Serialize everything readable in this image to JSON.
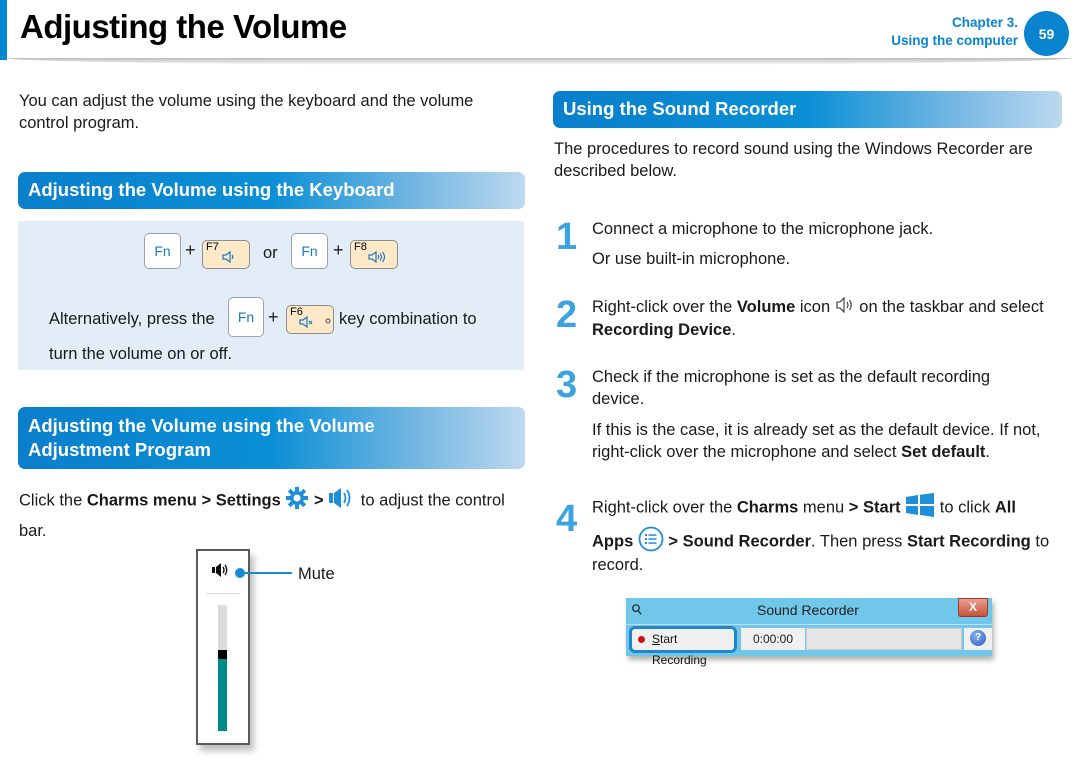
{
  "header": {
    "title": "Adjusting the Volume",
    "chapter_line1": "Chapter 3.",
    "chapter_line2": "Using the computer",
    "page_number": "59",
    "accent_color": "#0a84cf"
  },
  "left": {
    "intro": "You can adjust the volume using the keyboard and the volume control program.",
    "section1": {
      "heading": "Adjusting the Volume using the Keyboard",
      "combo1": {
        "key1": "Fn",
        "plus": "+",
        "key2_label": "F7",
        "key2_icon": "volume-down-icon"
      },
      "or_text": "or",
      "combo2": {
        "key1": "Fn",
        "plus": "+",
        "key2_label": "F8",
        "key2_icon": "volume-up-icon"
      },
      "alt_text_before": "Alternatively, press the",
      "alt_key1": "Fn",
      "alt_plus": "+",
      "alt_key2_label": "F6",
      "alt_key2_icon": "mute-icon",
      "alt_text_after": "key combination to",
      "alt_text_line2": "turn the volume on or off."
    },
    "section2": {
      "heading_line1": "Adjusting the Volume using the Volume",
      "heading_line2": "Adjustment Program",
      "text_prefix": "Click the ",
      "charms": "Charms menu",
      "sep1": " > ",
      "settings": "Settings",
      "sep2": " > ",
      "text_suffix": " to adjust the control",
      "text_line2": "bar.",
      "mute_label": "Mute",
      "volume_level_percent": 57
    }
  },
  "right": {
    "heading": "Using the Sound Recorder",
    "intro": "The procedures to record sound using the Windows Recorder are described below.",
    "steps": [
      {
        "number": "1",
        "line1": "Connect a microphone to the microphone jack.",
        "line2": "Or use built-in microphone."
      },
      {
        "number": "2",
        "t1": "Right-click over the ",
        "b1": "Volume",
        "t2": " icon ",
        "t3": " on the taskbar and select",
        "b2": "Recording Device",
        "t4": "."
      },
      {
        "number": "3",
        "line1": "Check if the microphone is set as the default recording device.",
        "t1": "If this is the case, it is already set as the default device. If not, right-click over the microphone and select ",
        "b1": "Set default",
        "t2": "."
      },
      {
        "number": "4",
        "t1": "Right-click over the ",
        "b1": "Charms",
        "t2": " menu ",
        "b2": "> Start",
        "t3": " to click ",
        "b3": "All",
        "b4": "Apps",
        "b5": " > Sound Recorder",
        "t4": ". Then press ",
        "b6": "Start Recording",
        "t5": " to",
        "t6": "record."
      }
    ],
    "recorder": {
      "title": "Sound Recorder",
      "close_label": "X",
      "start_button_first": "S",
      "start_button_rest": "tart Recording",
      "time": "0:00:00",
      "help_label": "?"
    }
  }
}
